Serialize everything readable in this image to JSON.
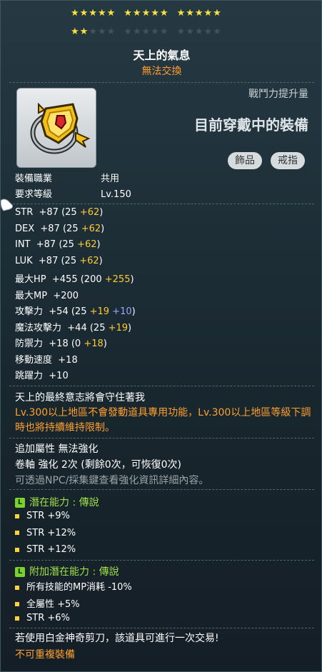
{
  "stars": {
    "row1": [
      5,
      5,
      5
    ],
    "row2_filled": 2,
    "row2_total": 15,
    "char": "★"
  },
  "item": {
    "name": "天上的氣息",
    "trade_status": "無法交換",
    "icon": "gold-heart-ring-icon",
    "cp_label": "戰鬥力提升量",
    "equipped_text": "目前穿戴中的裝備",
    "tags": [
      "飾品",
      "戒指"
    ]
  },
  "requirements": [
    {
      "label": "裝備職業",
      "value": "共用"
    },
    {
      "label": "要求等級",
      "value": "Lv.150"
    }
  ],
  "stats": [
    {
      "label": "STR",
      "total": "+87",
      "open": "(25 ",
      "parts": [
        {
          "v": "+62",
          "c": "y"
        }
      ],
      "close": ")"
    },
    {
      "label": "DEX",
      "total": "+87",
      "open": "(25 ",
      "parts": [
        {
          "v": "+62",
          "c": "y"
        }
      ],
      "close": ")"
    },
    {
      "label": "INT",
      "total": "+87",
      "open": "(25 ",
      "parts": [
        {
          "v": "+62",
          "c": "y"
        }
      ],
      "close": ")"
    },
    {
      "label": "LUK",
      "total": "+87",
      "open": "(25 ",
      "parts": [
        {
          "v": "+62",
          "c": "y"
        }
      ],
      "close": ")"
    },
    {
      "label": "最大HP",
      "total": "+455",
      "open": "(200 ",
      "parts": [
        {
          "v": "+255",
          "c": "y"
        }
      ],
      "close": ")"
    },
    {
      "label": "最大MP",
      "total": "+200",
      "open": "",
      "parts": [],
      "close": ""
    },
    {
      "label": "攻擊力",
      "total": "+54",
      "open": "(25 ",
      "parts": [
        {
          "v": "+19",
          "c": "y"
        },
        {
          "v": " +10",
          "c": "b"
        }
      ],
      "close": ")"
    },
    {
      "label": "魔法攻擊力",
      "total": "+44",
      "open": "(25 ",
      "parts": [
        {
          "v": "+19",
          "c": "y"
        }
      ],
      "close": ")"
    },
    {
      "label": "防禦力",
      "total": "+18",
      "open": "(0 ",
      "parts": [
        {
          "v": "+18",
          "c": "y"
        }
      ],
      "close": ")"
    },
    {
      "label": "移動速度",
      "total": "+18",
      "open": "",
      "parts": [],
      "close": ""
    },
    {
      "label": "跳躍力",
      "total": "+10",
      "open": "",
      "parts": [],
      "close": ""
    }
  ],
  "description": "天上的最終意志將會守住著我",
  "level_note": "Lv.300以上地區不會發動道具專用功能，Lv.300以上地區等級下調時也將持續維持限制。",
  "enhance": {
    "extra_attr": "追加屬性 無法強化",
    "scroll_line": "卷軸 強化 2次 (剩餘0次，可恢復0次)",
    "hint": "可透過NPC/採集鍵查看強化資訊詳細內容。"
  },
  "potential": {
    "badge": "L",
    "title": "潛在能力 : 傳說",
    "lines": [
      "STR +9%",
      "STR +12%",
      "STR +12%"
    ]
  },
  "additional_potential": {
    "badge": "L",
    "title": "附加潛在能力 : 傳說",
    "lines": [
      "所有技能的MP消耗 -10%",
      "全屬性 +5%",
      "STR +6%"
    ]
  },
  "footer": {
    "scissors_note": "若使用白金神奇剪刀，該道具可進行一次交易!",
    "no_reequip": "不可重複裝備"
  },
  "colors": {
    "star_on": "#ffe23c",
    "star_off": "#44525a",
    "bonus_yellow": "#ffcc33",
    "bonus_blue": "#9aa6ff",
    "orange": "#ffa030",
    "legendary_green": "#7ad12a"
  }
}
